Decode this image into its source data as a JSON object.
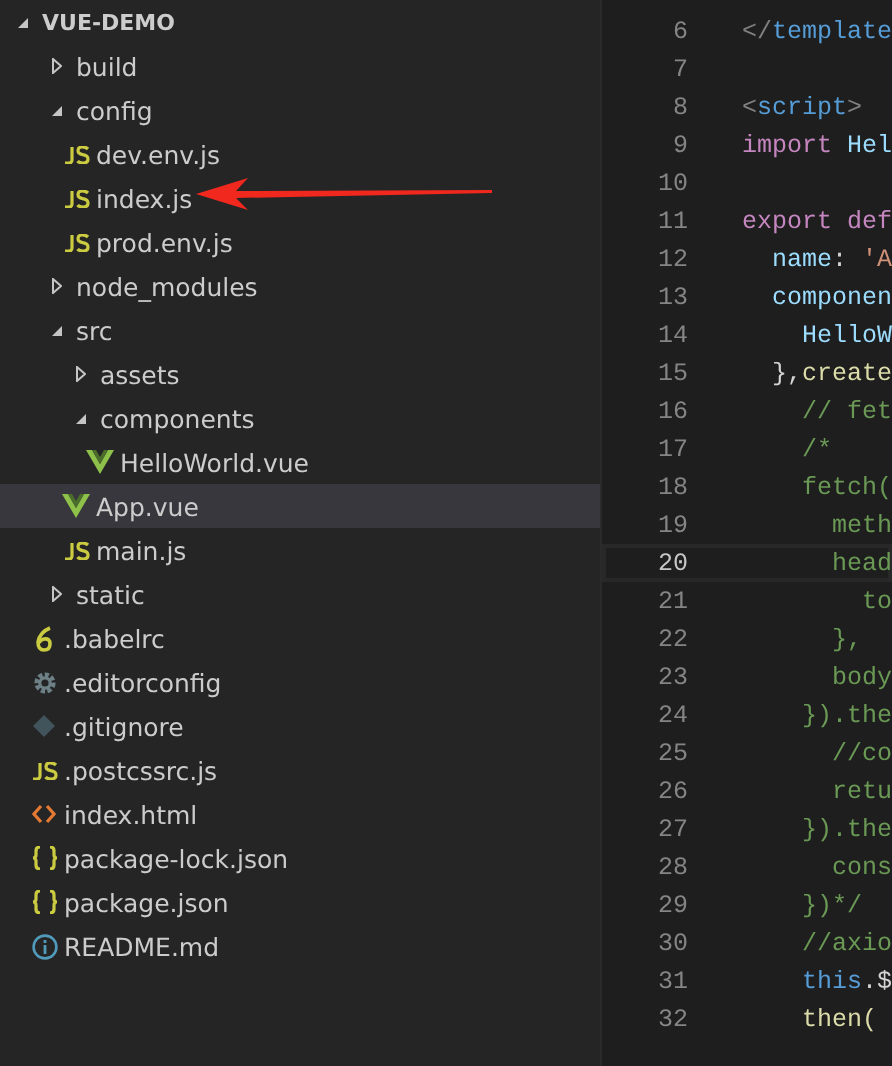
{
  "explorer": {
    "title": "VUE-DEMO",
    "expanded": true,
    "items": [
      {
        "label": "build",
        "kind": "folder",
        "expanded": false,
        "selected": false
      },
      {
        "label": "config",
        "kind": "folder",
        "expanded": true,
        "selected": false,
        "children": [
          {
            "label": "dev.env.js",
            "kind": "js",
            "selected": false
          },
          {
            "label": "index.js",
            "kind": "js",
            "selected": false
          },
          {
            "label": "prod.env.js",
            "kind": "js",
            "selected": false
          }
        ]
      },
      {
        "label": "node_modules",
        "kind": "folder",
        "expanded": false,
        "selected": false
      },
      {
        "label": "src",
        "kind": "folder",
        "expanded": true,
        "selected": false,
        "children": [
          {
            "label": "assets",
            "kind": "folder",
            "expanded": false,
            "selected": false
          },
          {
            "label": "components",
            "kind": "folder",
            "expanded": true,
            "selected": false,
            "children": [
              {
                "label": "HelloWorld.vue",
                "kind": "vue",
                "selected": false
              }
            ]
          },
          {
            "label": "App.vue",
            "kind": "vue",
            "selected": true
          },
          {
            "label": "main.js",
            "kind": "js",
            "selected": false
          }
        ]
      },
      {
        "label": "static",
        "kind": "folder",
        "expanded": false,
        "selected": false
      },
      {
        "label": ".babelrc",
        "kind": "babel",
        "selected": false
      },
      {
        "label": ".editorconfig",
        "kind": "config",
        "selected": false
      },
      {
        "label": ".gitignore",
        "kind": "git",
        "selected": false
      },
      {
        "label": ".postcssrc.js",
        "kind": "js",
        "selected": false
      },
      {
        "label": "index.html",
        "kind": "html",
        "selected": false
      },
      {
        "label": "package-lock.json",
        "kind": "json",
        "selected": false
      },
      {
        "label": "package.json",
        "kind": "json",
        "selected": false
      },
      {
        "label": "README.md",
        "kind": "info",
        "selected": false
      }
    ]
  },
  "editor": {
    "lines": [
      {
        "number": "6",
        "current": false,
        "tokens": [
          {
            "text": "</",
            "kind": "punct"
          },
          {
            "text": "template",
            "kind": "tag"
          }
        ]
      },
      {
        "number": "7",
        "current": false
      },
      {
        "number": "8",
        "current": false,
        "tokens": [
          {
            "text": "<",
            "kind": "punct"
          },
          {
            "text": "script",
            "kind": "tag"
          },
          {
            "text": ">",
            "kind": "punct"
          }
        ]
      },
      {
        "number": "9",
        "current": false,
        "tokens": [
          {
            "text": "import",
            "kind": "keyword"
          },
          {
            "text": " Hel",
            "kind": "var"
          }
        ]
      },
      {
        "number": "10",
        "current": false
      },
      {
        "number": "11",
        "current": false,
        "tokens": [
          {
            "text": "export def",
            "kind": "keyword"
          }
        ]
      },
      {
        "number": "12",
        "current": false,
        "tokens": [
          {
            "text": "  name",
            "kind": "var"
          },
          {
            "text": ": ",
            "kind": "plain"
          },
          {
            "text": "'A",
            "kind": "string"
          }
        ]
      },
      {
        "number": "13",
        "current": false,
        "tokens": [
          {
            "text": "  componen",
            "kind": "var"
          }
        ]
      },
      {
        "number": "14",
        "current": false,
        "tokens": [
          {
            "text": "    HelloW",
            "kind": "var"
          }
        ]
      },
      {
        "number": "15",
        "current": false,
        "tokens": [
          {
            "text": "  },",
            "kind": "plain"
          },
          {
            "text": "create",
            "kind": "func"
          }
        ]
      },
      {
        "number": "16",
        "current": false,
        "tokens": [
          {
            "text": "    // fet",
            "kind": "comment"
          }
        ]
      },
      {
        "number": "17",
        "current": false,
        "tokens": [
          {
            "text": "    /*",
            "kind": "comment"
          }
        ]
      },
      {
        "number": "18",
        "current": false,
        "tokens": [
          {
            "text": "    fetch(",
            "kind": "comment"
          }
        ]
      },
      {
        "number": "19",
        "current": false,
        "tokens": [
          {
            "text": "      meth",
            "kind": "comment"
          }
        ]
      },
      {
        "number": "20",
        "current": true,
        "tokens": [
          {
            "text": "      head",
            "kind": "comment"
          }
        ]
      },
      {
        "number": "21",
        "current": false,
        "tokens": [
          {
            "text": "        to",
            "kind": "comment"
          }
        ]
      },
      {
        "number": "22",
        "current": false,
        "tokens": [
          {
            "text": "      },",
            "kind": "comment"
          }
        ]
      },
      {
        "number": "23",
        "current": false,
        "tokens": [
          {
            "text": "      body",
            "kind": "comment"
          }
        ]
      },
      {
        "number": "24",
        "current": false,
        "tokens": [
          {
            "text": "    }).the",
            "kind": "comment"
          }
        ]
      },
      {
        "number": "25",
        "current": false,
        "tokens": [
          {
            "text": "      //co",
            "kind": "comment"
          }
        ]
      },
      {
        "number": "26",
        "current": false,
        "tokens": [
          {
            "text": "      retu",
            "kind": "comment"
          }
        ]
      },
      {
        "number": "27",
        "current": false,
        "tokens": [
          {
            "text": "    }).the",
            "kind": "comment"
          }
        ]
      },
      {
        "number": "28",
        "current": false,
        "tokens": [
          {
            "text": "      cons",
            "kind": "comment"
          }
        ]
      },
      {
        "number": "29",
        "current": false,
        "tokens": [
          {
            "text": "    })*/",
            "kind": "comment"
          }
        ]
      },
      {
        "number": "30",
        "current": false,
        "tokens": [
          {
            "text": "    //axio",
            "kind": "comment"
          }
        ]
      },
      {
        "number": "31",
        "current": false,
        "tokens": [
          {
            "text": "    this",
            "kind": "tag"
          },
          {
            "text": ".$",
            "kind": "plain"
          }
        ]
      },
      {
        "number": "32",
        "current": false,
        "tokens": [
          {
            "text": "    then(",
            "kind": "func"
          }
        ]
      }
    ]
  }
}
